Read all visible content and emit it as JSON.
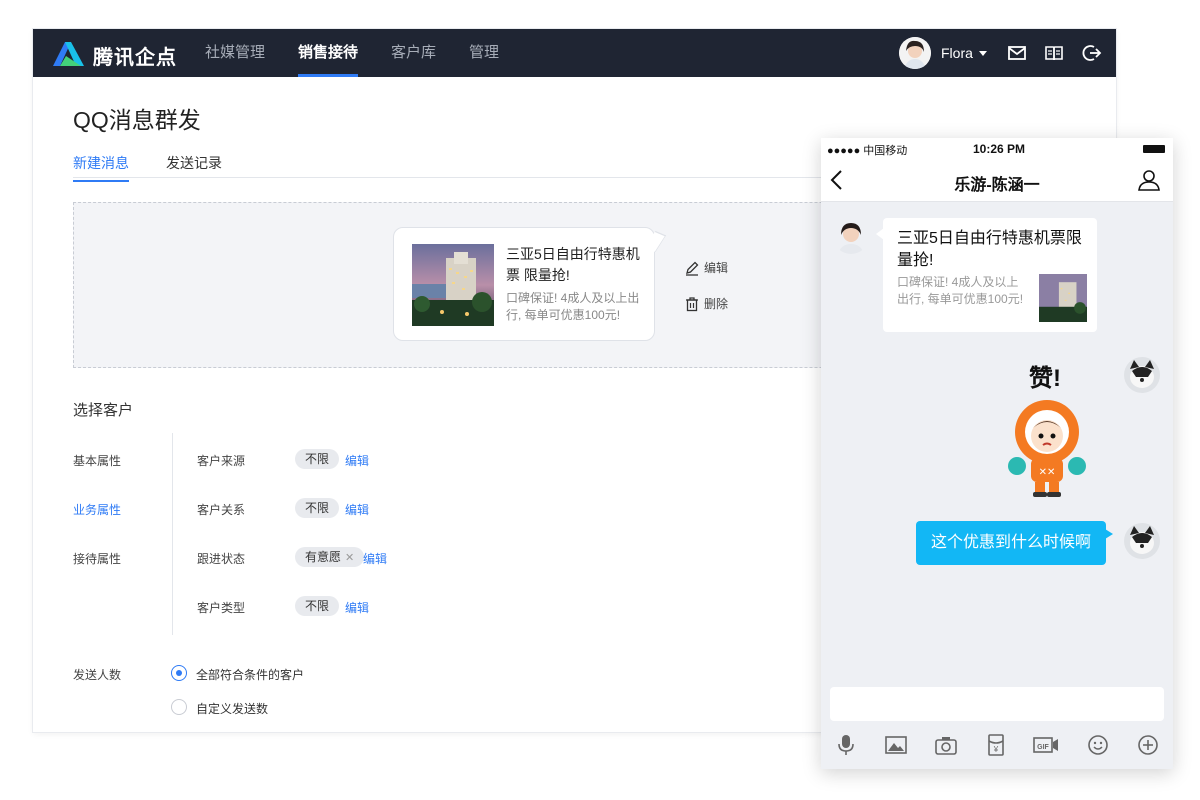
{
  "app": {
    "brand": "腾讯企点",
    "nav": [
      "社媒管理",
      "销售接待",
      "客户库",
      "管理"
    ],
    "active_nav": "销售接待",
    "user_name": "Flora",
    "page_title": "QQ消息群发",
    "tabs": [
      "新建消息",
      "发送记录"
    ],
    "message_card": {
      "title": "三亚5日自由行特惠机票 限量抢!",
      "desc": "口碑保证! 4成人及以上出行, 每单可优惠100元!"
    },
    "actions": {
      "edit": "编辑",
      "delete": "删除"
    },
    "customer_section": {
      "title": "选择客户",
      "attributes": [
        "基本属性",
        "业务属性",
        "接待属性"
      ],
      "fields": [
        {
          "label": "客户来源",
          "value": "不限",
          "edit": "编辑"
        },
        {
          "label": "客户关系",
          "value": "不限",
          "edit": "编辑"
        },
        {
          "label": "跟进状态",
          "value": "有意愿",
          "edit": "编辑"
        },
        {
          "label": "客户类型",
          "value": "不限",
          "edit": "编辑"
        }
      ]
    },
    "send_count": {
      "label": "发送人数",
      "options": [
        "全部符合条件的客户",
        "自定义发送数"
      ],
      "selected": "全部符合条件的客户"
    }
  },
  "phone": {
    "carrier": "●●●●● 中国移动",
    "time": "10:26 PM",
    "chat_title": "乐游-陈涵一",
    "share_card": {
      "title": "三亚5日自由行特惠机票限量抢!",
      "desc": "口碑保证! 4成人及以上出行, 每单可优惠100元!"
    },
    "sticker_text": "赞!",
    "user_message": "这个优惠到什么时候啊",
    "toolbar_icons": [
      "mic-icon",
      "image-icon",
      "camera-icon",
      "red-packet-icon",
      "gif-icon",
      "emoji-icon",
      "plus-icon"
    ]
  },
  "colors": {
    "topbar": "#1f2533",
    "accent": "#2f7bf5",
    "qq_blue": "#12b7f5"
  }
}
